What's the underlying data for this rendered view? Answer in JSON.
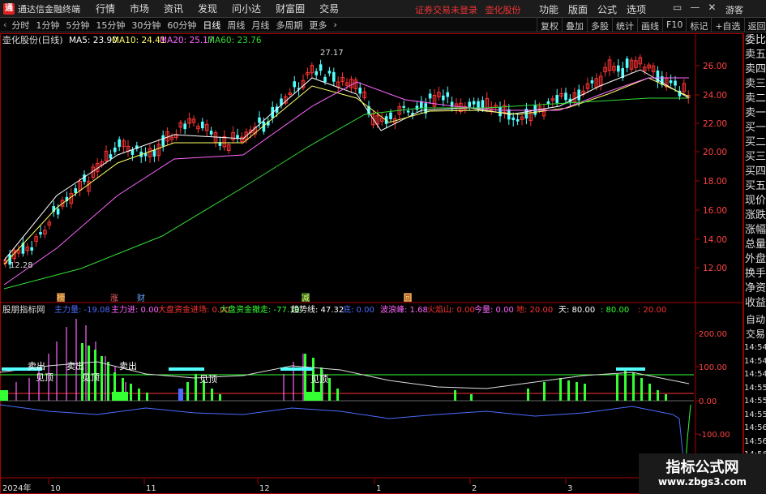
{
  "menubar": {
    "logo_char": "通",
    "app_title": "通达信金融终端",
    "items": [
      "行情",
      "市场",
      "资讯",
      "发现",
      "问小达",
      "财富圈",
      "交易"
    ],
    "login_status": "证券交易未登录",
    "stock_link": "壶化股份",
    "right_items": [
      "功能",
      "版面",
      "公式",
      "选项"
    ],
    "window_controls": [
      "▭",
      "—",
      "✕"
    ],
    "guest": "游客"
  },
  "toolbar": {
    "periods": [
      "分时",
      "1分钟",
      "5分钟",
      "15分钟",
      "30分钟",
      "60分钟",
      "日线",
      "周线",
      "月线",
      "多周期",
      "更多"
    ],
    "active": "日线",
    "right_items": [
      "复权",
      "叠加",
      "多股",
      "统计",
      "画线",
      "F10",
      "标记",
      "+自选",
      "返回"
    ]
  },
  "main_chart": {
    "stock_title": "壶化股份(日线)",
    "ma5_label": "MA5: 23.90",
    "ma10_label": "MA10: 24.41",
    "ma20_label": "MA20: 25.17",
    "ma60_label": "MA60: 23.76",
    "y_ticks": [
      "26.00",
      "24.00",
      "22.00",
      "20.00",
      "18.00",
      "16.00",
      "14.00",
      "12.00"
    ],
    "high_label": "27.17",
    "low_label": "12.28",
    "markers": [
      "榜",
      "涨",
      "财",
      "减",
      "回"
    ]
  },
  "indicator": {
    "name": "股朋指标网",
    "items": [
      {
        "text": "主力量: -19.08",
        "color": "#4a6cff"
      },
      {
        "text": "主力进: 0.00",
        "color": "#ff66ff"
      },
      {
        "text": "大盘资金进场: 0.00",
        "color": "#ff3333"
      },
      {
        "text": "大盘资金撤走: -77.10",
        "color": "#33ff33"
      },
      {
        "text": "趋势线: 47.32",
        "color": "#ffffff"
      },
      {
        "text": "底: 0.00",
        "color": "#4a6cff"
      },
      {
        "text": "波浪峰: 1.68",
        "color": "#ff66ff"
      },
      {
        "text": "火焰山: 0.00",
        "color": "#ff3333"
      },
      {
        "text": "今量: 0.00",
        "color": "#ff66ff"
      },
      {
        "text": "地: 20.00",
        "color": "#ff3333"
      },
      {
        "text": "天: 80.00",
        "color": "#ffffff"
      },
      {
        "text": ": 80.00",
        "color": "#33ff33"
      },
      {
        "text": ": 20.00",
        "color": "#ff3333"
      }
    ],
    "y_ticks": [
      "200.00",
      "100.00",
      "0.00",
      "-100.00"
    ],
    "sell_label": "卖出",
    "top_label": "见顶"
  },
  "time_axis": {
    "year_label": "2024年",
    "months": [
      "10",
      "11",
      "12",
      "1",
      "2",
      "3"
    ]
  },
  "side_panel": {
    "items": [
      "委比",
      "卖五",
      "卖四",
      "卖三",
      "卖二",
      "卖一",
      "买一",
      "买二",
      "买三",
      "买四",
      "买五",
      "现价",
      "涨跌",
      "涨幅",
      "总量",
      "外盘",
      "换手",
      "净资",
      "收益",
      "自动",
      "交易"
    ],
    "times": [
      "14:54",
      "14:54",
      "14:54",
      "14:55",
      "14:55",
      "14:55",
      "14:56",
      "14:56",
      "14:56"
    ]
  },
  "watermark": {
    "title": "指标公式网",
    "url": "www.zbgs3.com"
  },
  "colors": {
    "up": "#ff3333",
    "down": "#54ffff",
    "ma5": "#ffffff",
    "ma10": "#ffff66",
    "ma20": "#ff66ff",
    "ma60": "#33dd33",
    "axis": "#aa0000"
  }
}
